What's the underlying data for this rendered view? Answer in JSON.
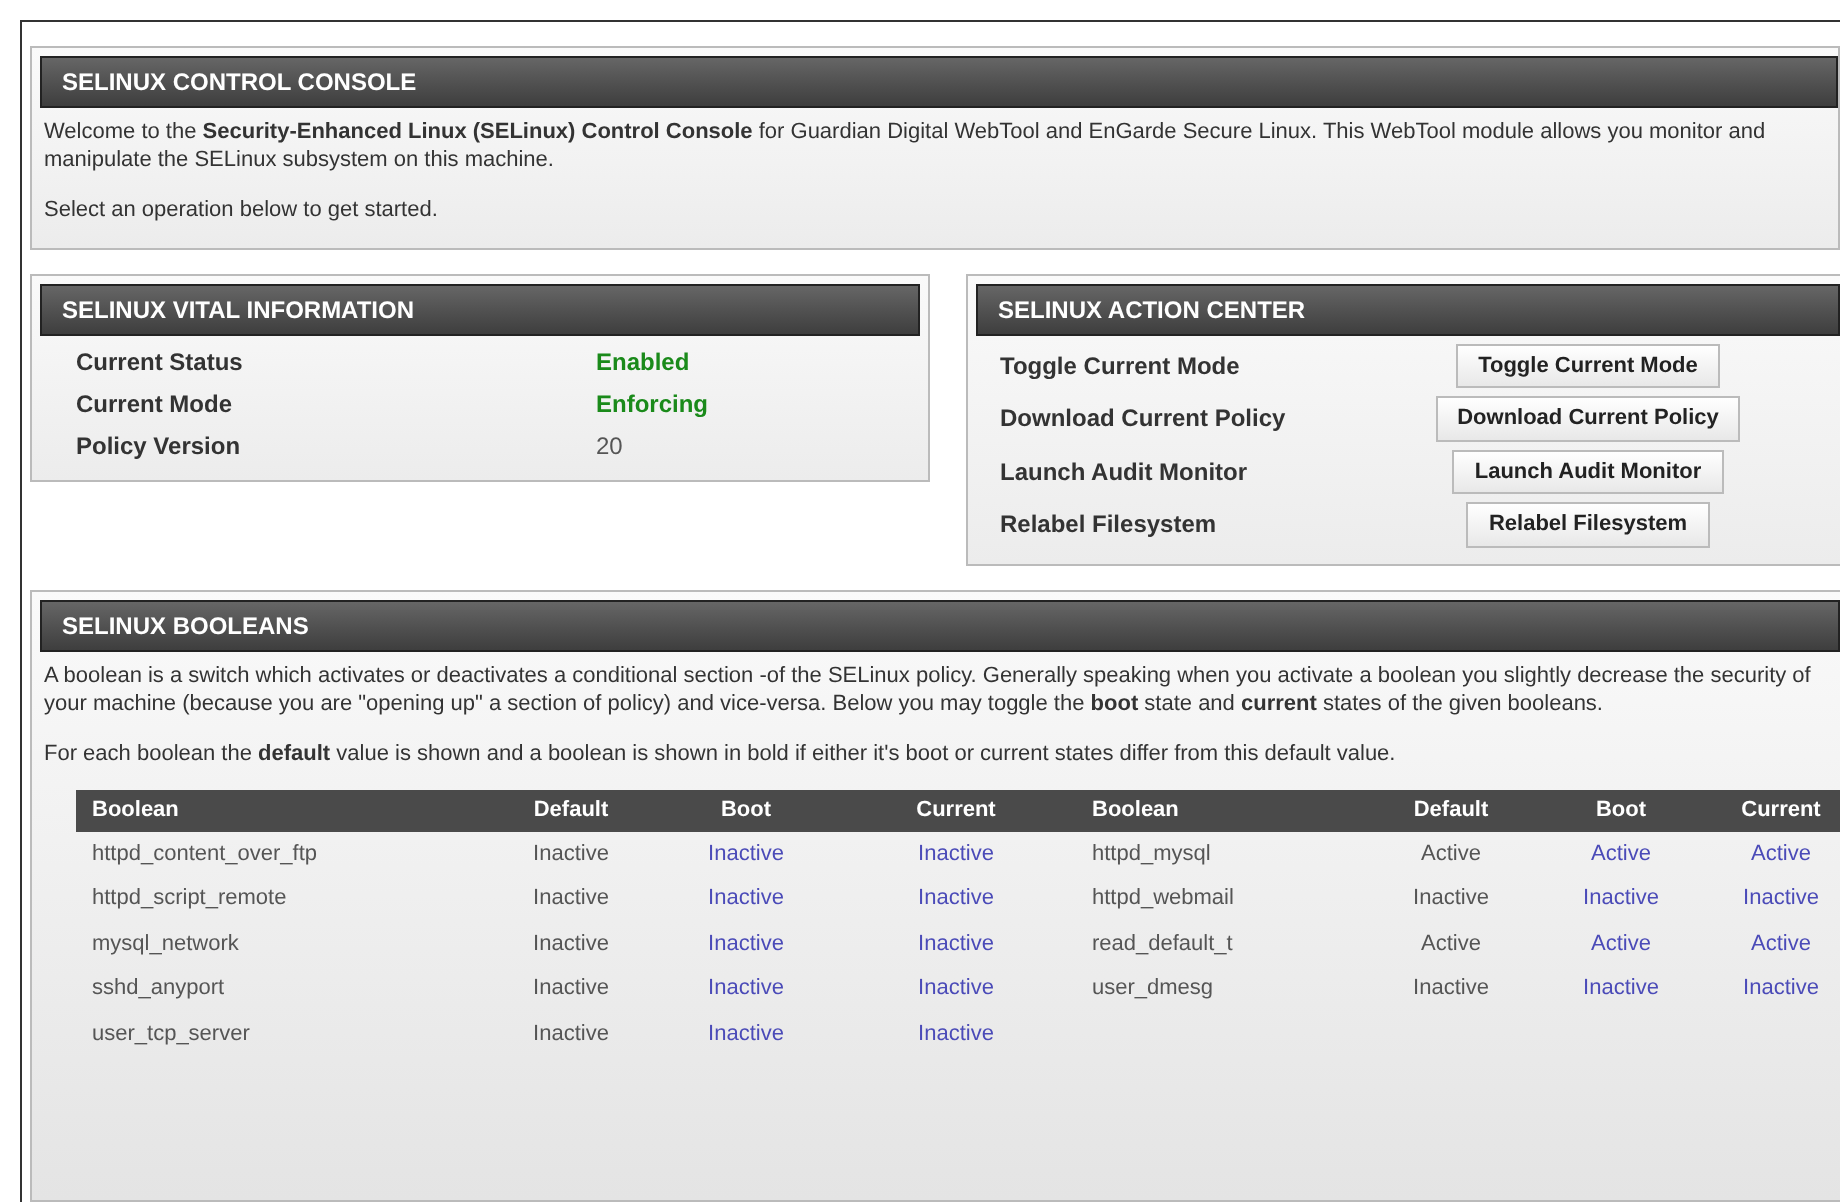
{
  "console": {
    "title": "SELINUX CONTROL CONSOLE",
    "intro": "Welcome to the **Security-Enhanced Linux (SELinux) Control Console** for Guardian Digital WebTool and EnGarde Secure Linux. This WebTool module allows you monitor and manipulate the SELinux subsystem on this machine.",
    "prompt": "Select an operation below to get started."
  },
  "vital": {
    "title": "SELINUX VITAL INFORMATION",
    "rows": [
      {
        "label": "Current Status",
        "value": "Enabled",
        "kind": "status"
      },
      {
        "label": "Current Mode",
        "value": "Enforcing",
        "kind": "status"
      },
      {
        "label": "Policy Version",
        "value": "20",
        "kind": "plain"
      }
    ]
  },
  "actions": {
    "title": "SELINUX ACTION CENTER",
    "rows": [
      {
        "label": "Toggle Current Mode",
        "button": "Toggle Current Mode"
      },
      {
        "label": "Download Current Policy",
        "button": "Download Current Policy"
      },
      {
        "label": "Launch Audit Monitor",
        "button": "Launch Audit Monitor"
      },
      {
        "label": "Relabel Filesystem",
        "button": "Relabel Filesystem"
      }
    ]
  },
  "booleans": {
    "title": "SELINUX BOOLEANS",
    "description": "A boolean is a switch which activates or deactivates a conditional section -of the SELinux policy. Generally speaking when you activate a boolean you slightly decrease the security of your machine (because you are \"opening up\" a section of policy) and vice-versa. Below you may toggle the **boot** state and **current** states of the given booleans.",
    "note": "For each boolean the **default** value is shown and a boolean is shown in bold if either it's boot or current states differ from this default value.",
    "table": {
      "columns": [
        {
          "label": "Boolean",
          "kind": "name"
        },
        {
          "label": "Default",
          "kind": "value"
        },
        {
          "label": "Boot",
          "kind": "link"
        },
        {
          "label": "Current",
          "kind": "link"
        },
        {
          "label": "Boolean",
          "kind": "name"
        },
        {
          "label": "Default",
          "kind": "value"
        },
        {
          "label": "Boot",
          "kind": "link"
        },
        {
          "label": "Current",
          "kind": "link"
        }
      ],
      "rows": [
        [
          "httpd_content_over_ftp",
          "Inactive",
          "Inactive",
          "Inactive",
          "httpd_mysql",
          "Active",
          "Active",
          "Active"
        ],
        [
          "httpd_script_remote",
          "Inactive",
          "Inactive",
          "Inactive",
          "httpd_webmail",
          "Inactive",
          "Inactive",
          "Inactive"
        ],
        [
          "mysql_network",
          "Inactive",
          "Inactive",
          "Inactive",
          "read_default_t",
          "Active",
          "Active",
          "Active"
        ],
        [
          "sshd_anyport",
          "Inactive",
          "Inactive",
          "Inactive",
          "user_dmesg",
          "Inactive",
          "Inactive",
          "Inactive"
        ],
        [
          "user_tcp_server",
          "Inactive",
          "Inactive",
          "Inactive"
        ]
      ]
    }
  }
}
